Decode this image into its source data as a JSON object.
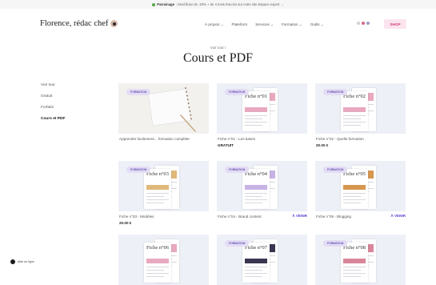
{
  "promo": {
    "highlight": "Parrainage",
    "text": ": bénéficiez de -20% + de 4 mois d'accès sur notre site Espace expert →"
  },
  "header": {
    "logo": "Florence, rédac chef",
    "nav": [
      "À propos ⌄",
      "Plateform",
      "Services ⌄",
      "Formation ⌄",
      "Outils ⌄"
    ],
    "shop_label": "SHOP",
    "icon_colors": [
      "#cfcfd6",
      "#d26a8a",
      "#9aa0c8"
    ]
  },
  "breadcrumb": "Voir tout /",
  "page_title": "Cours et PDF",
  "sidebar": {
    "items": [
      {
        "label": "Voir tout",
        "active": false
      },
      {
        "label": "Gratuit",
        "active": false
      },
      {
        "label": "Forfaits",
        "active": false
      },
      {
        "label": "Cours et PDF",
        "active": true
      }
    ]
  },
  "products": [
    {
      "badge": "FORMATION",
      "name": "Apprendre facilement... formation complète",
      "price": "",
      "status": "",
      "thumb": "notebook",
      "doc_title": "",
      "accent": "#e8a9c0"
    },
    {
      "badge": "FORMATION",
      "name": "Fiche n°01 - Les bases",
      "price": "GRATUIT",
      "status": "",
      "thumb": "doc",
      "doc_title": "Fiche n°01",
      "accent": "#e8a9c0"
    },
    {
      "badge": "FORMATION",
      "name": "Fiche n°02 - Quelle formation",
      "price": "20.00 €",
      "status": "",
      "thumb": "doc",
      "doc_title": "Fiche n°02",
      "accent": "#e8a9c0"
    },
    {
      "badge": "FORMATION",
      "name": "Fiche n°03 - Modèles",
      "price": "20.00 €",
      "status": "",
      "thumb": "doc",
      "doc_title": "Fiche n°03",
      "accent": "#e0b87a"
    },
    {
      "badge": "FORMATION",
      "name": "Fiche n°04 - Brand content",
      "price": "",
      "status": "À VENIR",
      "thumb": "doc",
      "doc_title": "Fiche n°04",
      "accent": "#c7b3e6"
    },
    {
      "badge": "FORMATION",
      "name": "Fiche n°05 - Blogging",
      "price": "",
      "status": "À VENIR",
      "thumb": "doc",
      "doc_title": "Fiche n°05",
      "accent": "#d6974f"
    },
    {
      "badge": "",
      "name": "",
      "price": "",
      "status": "",
      "thumb": "doc",
      "doc_title": "Fiche n°06",
      "accent": "#e8a9c0"
    },
    {
      "badge": "FORMATION",
      "name": "",
      "price": "",
      "status": "",
      "thumb": "doc",
      "doc_title": "Fiche n°07",
      "accent": "#3a3550"
    },
    {
      "badge": "FORMATION",
      "name": "",
      "price": "",
      "status": "",
      "thumb": "doc",
      "doc_title": "Fiche n°08",
      "accent": "#d9869b"
    }
  ],
  "chat_label": "Aide en ligne"
}
